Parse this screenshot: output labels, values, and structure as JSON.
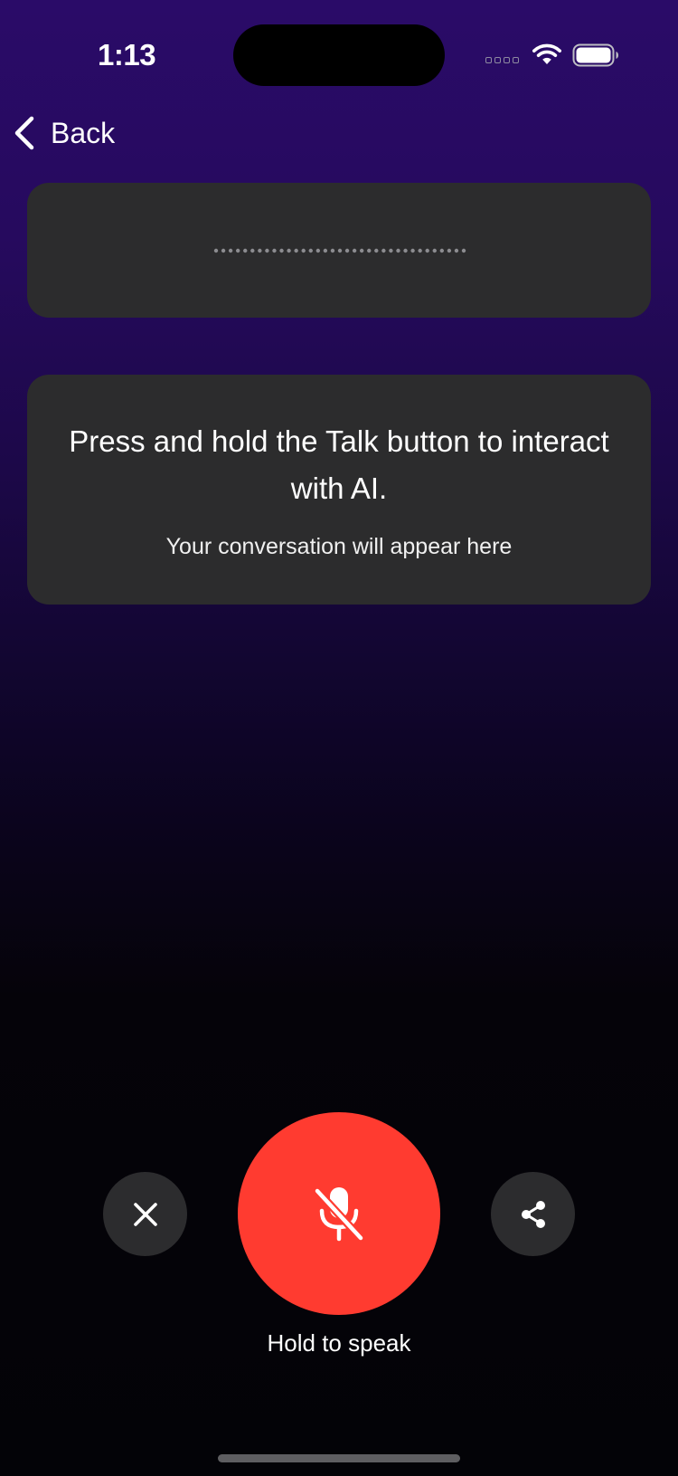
{
  "status_bar": {
    "time": "1:13",
    "wifi_icon": "wifi-icon",
    "battery_icon": "battery-icon",
    "signal_icon": "cellular-signal-icon"
  },
  "nav": {
    "back_label": "Back",
    "back_icon": "chevron-left-icon"
  },
  "waveform": {
    "icon": "audio-waveform-dots"
  },
  "conversation": {
    "title": "Press and hold the Talk button to interact with AI.",
    "subtitle": "Your conversation will appear here"
  },
  "controls": {
    "close_icon": "close-icon",
    "mic_icon": "mic-off-icon",
    "share_icon": "share-icon",
    "hold_label": "Hold to speak"
  },
  "colors": {
    "background_top": "#2a0b68",
    "background_bottom": "#030307",
    "card": "#2c2c2d",
    "mic_button": "#ff3b30",
    "round_button": "#2c2c2e",
    "text": "#ffffff"
  }
}
